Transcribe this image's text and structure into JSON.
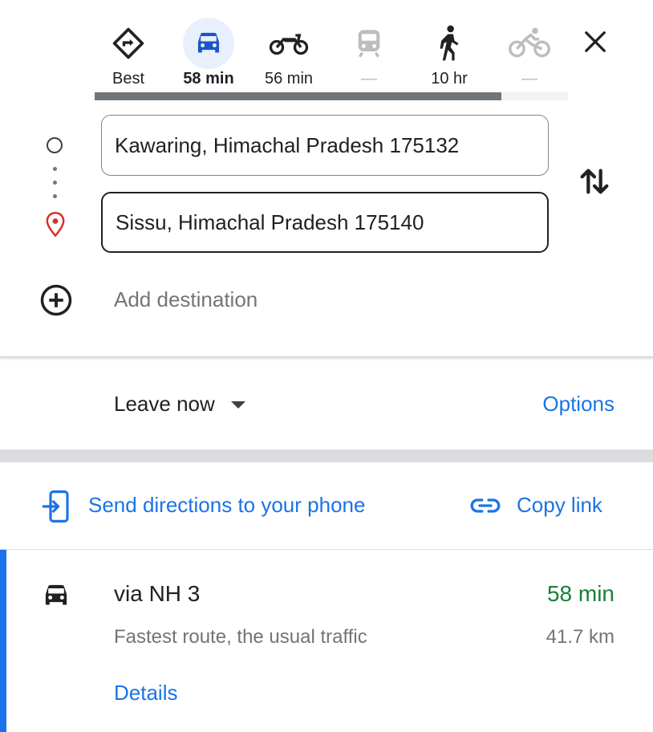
{
  "travel_modes": [
    {
      "id": "best",
      "icon": "directions-icon",
      "label": "Best",
      "selected": false,
      "dim": false
    },
    {
      "id": "driving",
      "icon": "car-icon",
      "label": "58 min",
      "selected": true,
      "dim": false
    },
    {
      "id": "two-wheeler",
      "icon": "motorcycle-icon",
      "label": "56 min",
      "selected": false,
      "dim": false
    },
    {
      "id": "transit",
      "icon": "train-icon",
      "label": "—",
      "selected": false,
      "dim": true
    },
    {
      "id": "walking",
      "icon": "walk-icon",
      "label": "10 hr",
      "selected": false,
      "dim": false
    },
    {
      "id": "cycling",
      "icon": "bicycle-icon",
      "label": "—",
      "selected": false,
      "dim": true
    }
  ],
  "progress": 0.86,
  "origin": {
    "value": "Kawaring, Himachal Pradesh 175132"
  },
  "destination": {
    "value": "Sissu, Himachal Pradesh 175140"
  },
  "add_destination": "Add destination",
  "departure": {
    "label": "Leave now",
    "options_label": "Options"
  },
  "share": {
    "send_label": "Send directions to your phone",
    "copy_label": "Copy link"
  },
  "route": {
    "title": "via NH 3",
    "time": "58 min",
    "description": "Fastest route, the usual traffic",
    "distance": "41.7 km",
    "details_label": "Details"
  },
  "colors": {
    "accent": "#1a73e8",
    "selected_bg": "#e8f0fe",
    "fast_green": "#188038",
    "pin_red": "#d93025"
  }
}
